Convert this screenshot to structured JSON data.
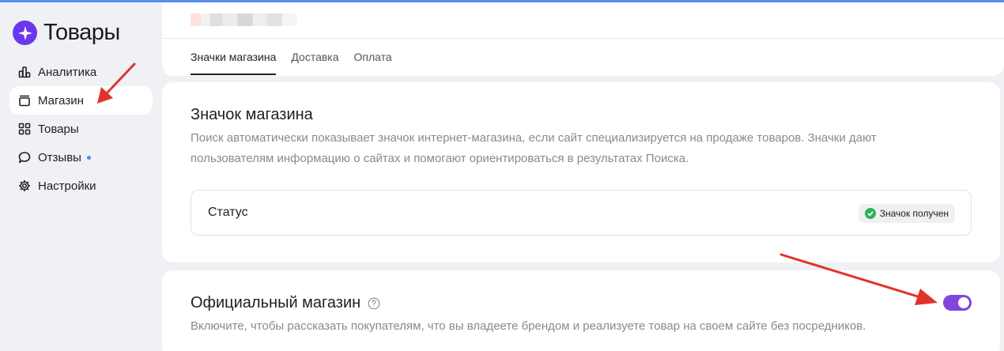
{
  "app": {
    "title": "Товары"
  },
  "sidebar": {
    "items": [
      {
        "label": "Аналитика",
        "icon": "chart-icon",
        "active": false
      },
      {
        "label": "Магазин",
        "icon": "store-icon",
        "active": true
      },
      {
        "label": "Товары",
        "icon": "grid-icon",
        "active": false
      },
      {
        "label": "Отзывы",
        "icon": "chat-icon",
        "active": false,
        "has_dot": true
      },
      {
        "label": "Настройки",
        "icon": "gear-icon",
        "active": false
      }
    ]
  },
  "header": {
    "tabs": [
      {
        "label": "Значки магазина",
        "active": true
      },
      {
        "label": "Доставка",
        "active": false
      },
      {
        "label": "Оплата",
        "active": false
      }
    ]
  },
  "store_badge_card": {
    "title": "Значок магазина",
    "description": "Поиск автоматически показывает значок интернет-магазина, если сайт специализируется на продаже товаров. Значки дают пользователям информацию о сайтах и помогают ориентироваться в результатах Поиска.",
    "status_label": "Статус",
    "status_badge": "Значок получен"
  },
  "official_store_card": {
    "title": "Официальный магазин",
    "description": "Включите, чтобы рассказать покупателям, что вы владеете брендом и реализуете товар на своем сайте без посредников.",
    "toggle_on": true
  },
  "colors": {
    "accent": "#7f45e0",
    "brand_logo": "#6a37f0",
    "success": "#2bb457",
    "annotation_arrow": "#e0342b",
    "notification_dot": "#4a8ef4"
  }
}
